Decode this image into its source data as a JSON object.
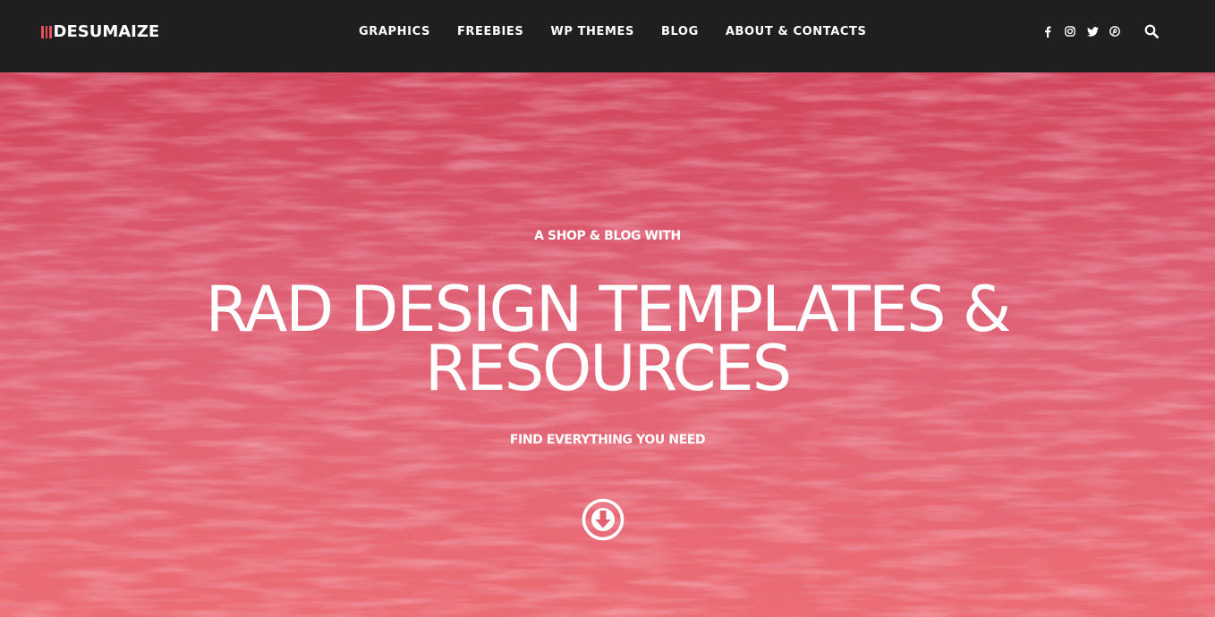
{
  "header": {
    "logo_text": "DESUMAIZE",
    "logo_bar_colors": [
      "#e8505b",
      "#e8505b",
      "#e8505b"
    ],
    "nav": [
      {
        "label": "GRAPHICS"
      },
      {
        "label": "FREEBIES"
      },
      {
        "label": "WP THEMES"
      },
      {
        "label": "BLOG"
      },
      {
        "label": "ABOUT & CONTACTS"
      }
    ],
    "social_icons": [
      "facebook-icon",
      "instagram-icon",
      "twitter-icon",
      "pinterest-icon"
    ],
    "search_icon": "search-icon"
  },
  "hero": {
    "kicker": "A SHOP & BLOG WITH",
    "title": "RAD DESIGN TEMPLATES & RESOURCES",
    "subtitle": "FIND EVERYTHING YOU NEED",
    "scroll_icon": "arrow-down-circle-icon"
  },
  "colors": {
    "header_bg": "#1f1f1f",
    "hero_bg_top": "#d94f63",
    "hero_bg_bottom": "#ec6c75",
    "text": "#ffffff"
  }
}
